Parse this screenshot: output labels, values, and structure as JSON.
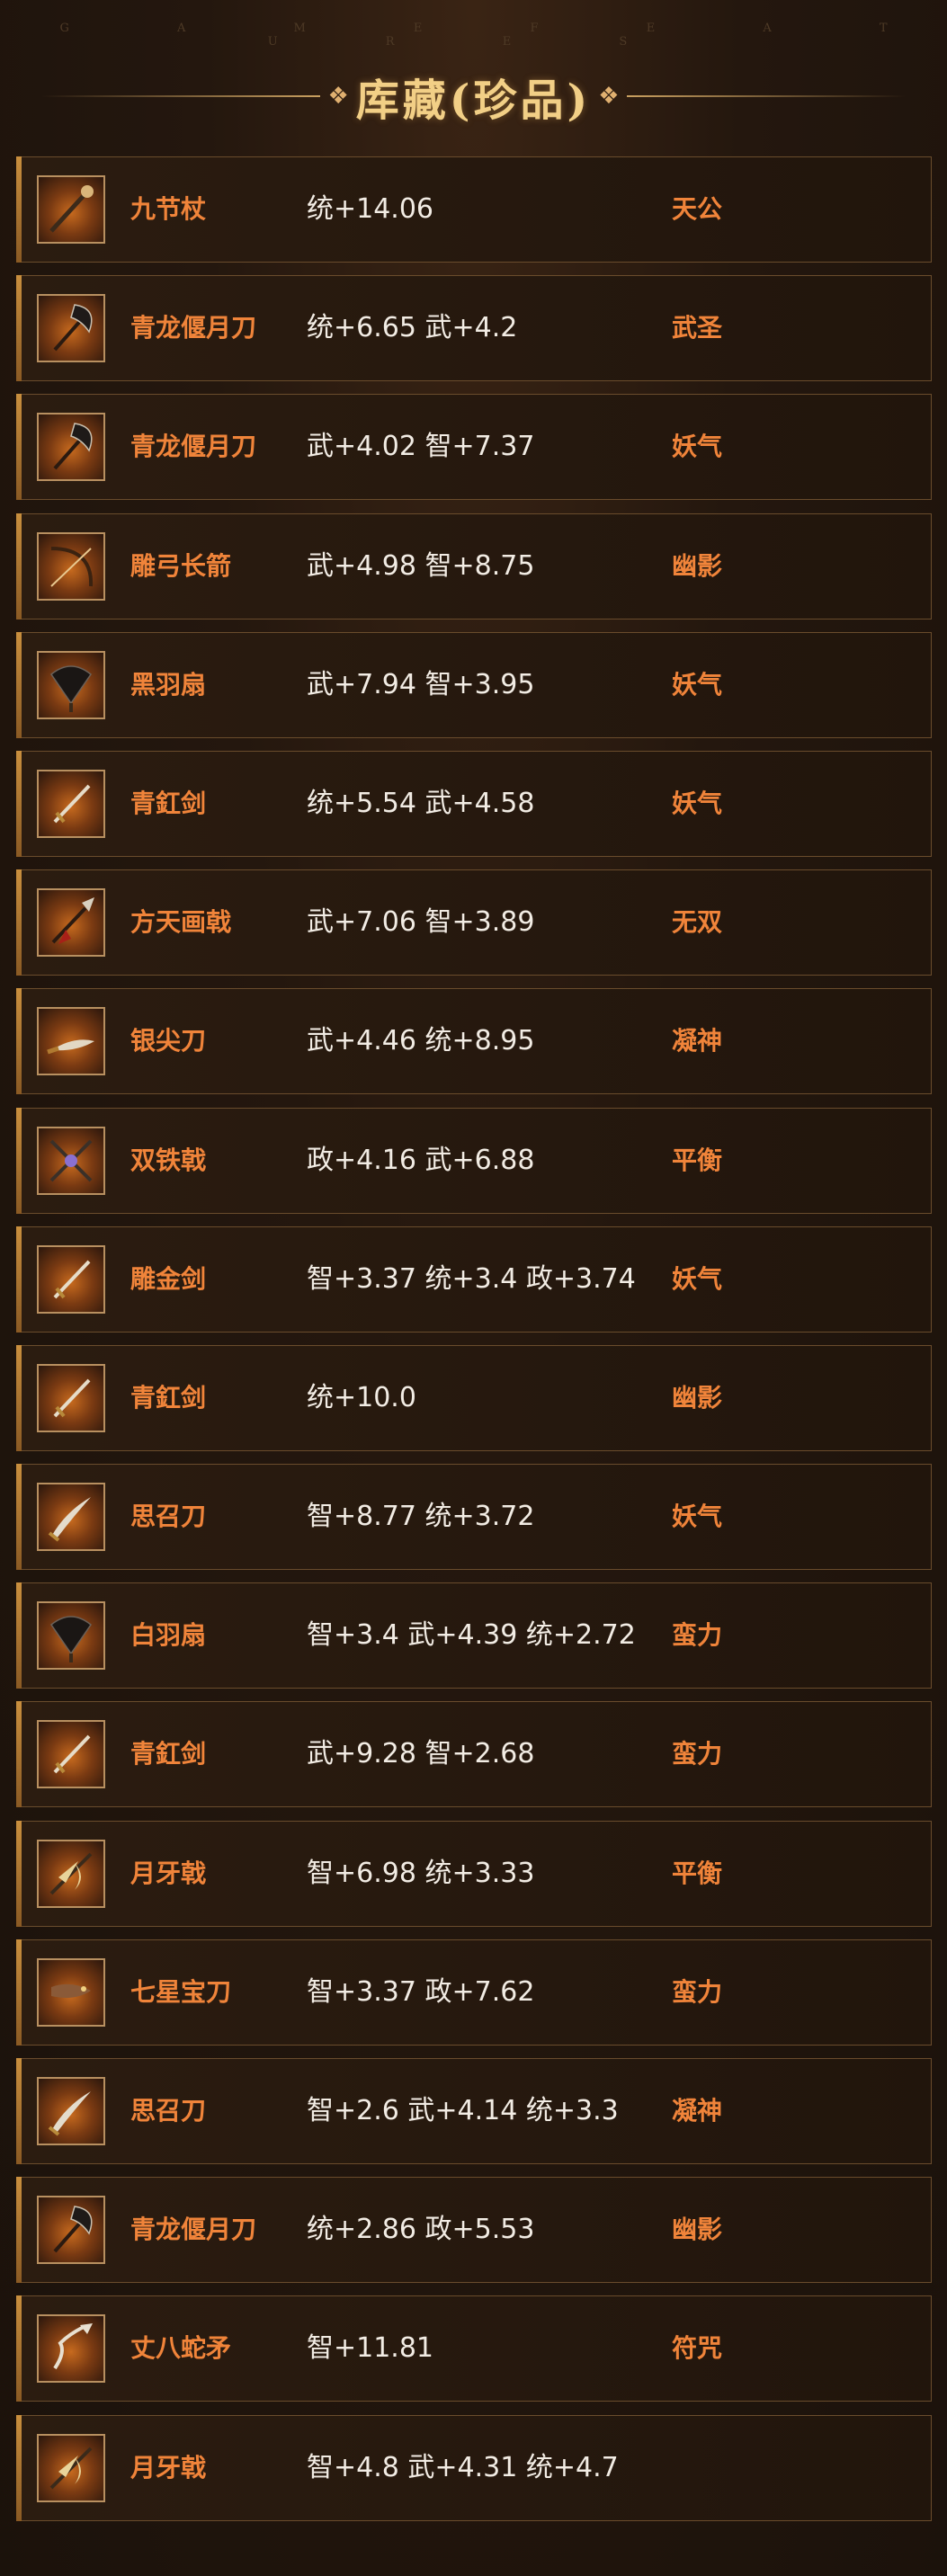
{
  "header": {
    "subtitle": "G A M E F E A T U R E S",
    "title": "库藏(珍品)",
    "ornament_left": "❖",
    "ornament_right": "❖"
  },
  "items": [
    {
      "name": "九节杖",
      "stats": "统+14.06",
      "tag": "天公",
      "icon": "staff-icon"
    },
    {
      "name": "青龙偃月刀",
      "stats": "统+6.65 武+4.2",
      "tag": "武圣",
      "icon": "glaive-icon"
    },
    {
      "name": "青龙偃月刀",
      "stats": "武+4.02 智+7.37",
      "tag": "妖气",
      "icon": "glaive-icon"
    },
    {
      "name": "雕弓长箭",
      "stats": "武+4.98 智+8.75",
      "tag": "幽影",
      "icon": "bow-icon"
    },
    {
      "name": "黑羽扇",
      "stats": "武+7.94 智+3.95",
      "tag": "妖气",
      "icon": "fan-icon"
    },
    {
      "name": "青釭剑",
      "stats": "统+5.54 武+4.58",
      "tag": "妖气",
      "icon": "sword-icon"
    },
    {
      "name": "方天画戟",
      "stats": "武+7.06 智+3.89",
      "tag": "无双",
      "icon": "halberd-icon"
    },
    {
      "name": "银尖刀",
      "stats": "武+4.46 统+8.95",
      "tag": "凝神",
      "icon": "blade-icon"
    },
    {
      "name": "双铁戟",
      "stats": "政+4.16 武+6.88",
      "tag": "平衡",
      "icon": "crossed-halberd-icon"
    },
    {
      "name": "雕金剑",
      "stats": "智+3.37 统+3.4 政+3.74",
      "tag": "妖气",
      "icon": "sword-icon"
    },
    {
      "name": "青釭剑",
      "stats": "统+10.0",
      "tag": "幽影",
      "icon": "sword-icon"
    },
    {
      "name": "思召刀",
      "stats": "智+8.77 统+3.72",
      "tag": "妖气",
      "icon": "saber-icon"
    },
    {
      "name": "白羽扇",
      "stats": "智+3.4 武+4.39 统+2.72",
      "tag": "蛮力",
      "icon": "fan-icon"
    },
    {
      "name": "青釭剑",
      "stats": "武+9.28 智+2.68",
      "tag": "蛮力",
      "icon": "sword-icon"
    },
    {
      "name": "月牙戟",
      "stats": "智+6.98 统+3.33",
      "tag": "平衡",
      "icon": "crescent-halberd-icon"
    },
    {
      "name": "七星宝刀",
      "stats": "智+3.37 政+7.62",
      "tag": "蛮力",
      "icon": "dragon-blade-icon"
    },
    {
      "name": "思召刀",
      "stats": "智+2.6 武+4.14 统+3.3",
      "tag": "凝神",
      "icon": "saber-icon"
    },
    {
      "name": "青龙偃月刀",
      "stats": "统+2.86 政+5.53",
      "tag": "幽影",
      "icon": "glaive-icon"
    },
    {
      "name": "丈八蛇矛",
      "stats": "智+11.81",
      "tag": "符咒",
      "icon": "serpent-spear-icon"
    },
    {
      "name": "月牙戟",
      "stats": "智+4.8 武+4.31 统+4.7",
      "tag": "",
      "icon": "crescent-halberd-icon"
    }
  ]
}
